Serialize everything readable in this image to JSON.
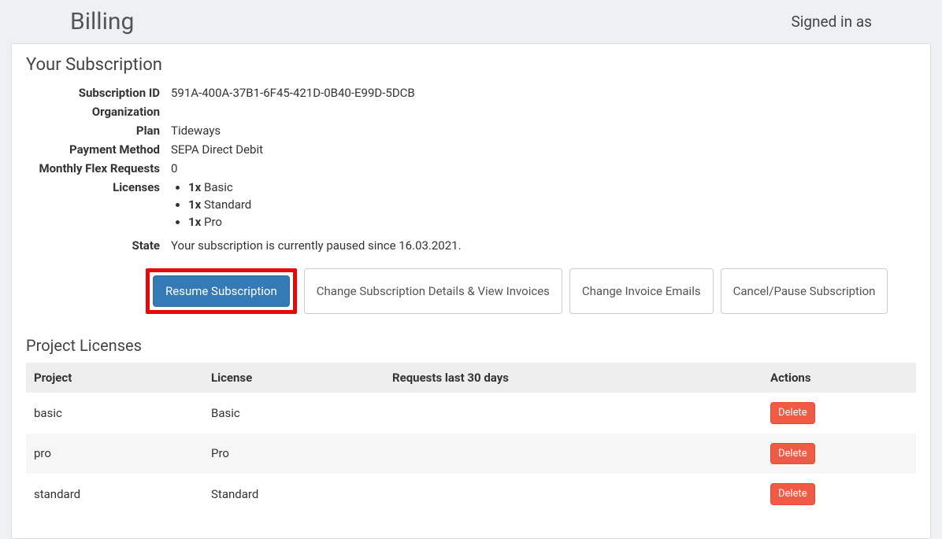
{
  "header": {
    "title": "Billing",
    "signed_in": "Signed in as"
  },
  "subscription_panel": {
    "heading": "Your Subscription",
    "labels": {
      "subscription_id": "Subscription ID",
      "organization": "Organization",
      "plan": "Plan",
      "payment_method": "Payment Method",
      "monthly_flex_requests": "Monthly Flex Requests",
      "licenses": "Licenses",
      "state": "State"
    },
    "values": {
      "subscription_id": "591A-400A-37B1-6F45-421D-0B40-E99D-5DCB",
      "organization": "",
      "plan": "Tideways",
      "payment_method": "SEPA Direct Debit",
      "monthly_flex_requests": "0",
      "state": "Your subscription is currently paused since 16.03.2021."
    },
    "licenses": [
      {
        "qty": "1x",
        "name": "Basic"
      },
      {
        "qty": "1x",
        "name": "Standard"
      },
      {
        "qty": "1x",
        "name": "Pro"
      }
    ],
    "buttons": {
      "resume": "Resume Subscription",
      "change_details": "Change Subscription Details & View Invoices",
      "change_emails": "Change Invoice Emails",
      "cancel_pause": "Cancel/Pause Subscription"
    }
  },
  "project_licenses": {
    "heading": "Project Licenses",
    "columns": {
      "project": "Project",
      "license": "License",
      "requests": "Requests last 30 days",
      "actions": "Actions"
    },
    "rows": [
      {
        "project": "basic",
        "license": "Basic",
        "requests": ""
      },
      {
        "project": "pro",
        "license": "Pro",
        "requests": ""
      },
      {
        "project": "standard",
        "license": "Standard",
        "requests": ""
      }
    ],
    "delete_label": "Delete"
  }
}
